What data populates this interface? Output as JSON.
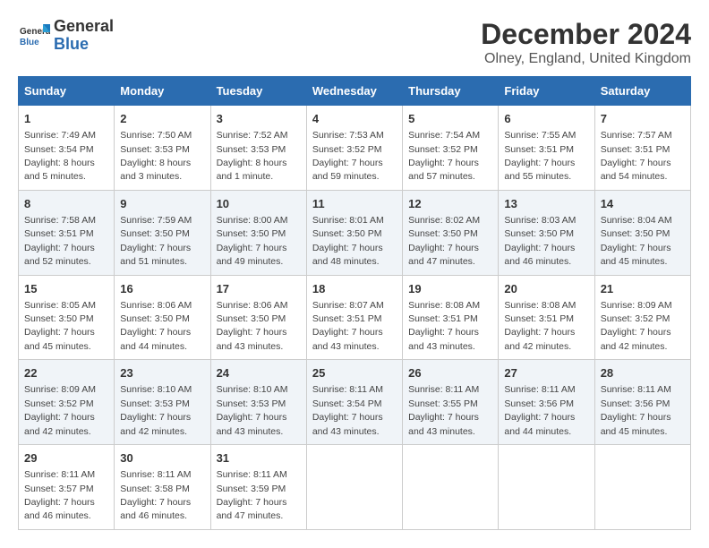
{
  "logo": {
    "line1": "General",
    "line2": "Blue"
  },
  "title": "December 2024",
  "location": "Olney, England, United Kingdom",
  "days_header": [
    "Sunday",
    "Monday",
    "Tuesday",
    "Wednesday",
    "Thursday",
    "Friday",
    "Saturday"
  ],
  "weeks": [
    [
      {
        "day": "1",
        "info": "Sunrise: 7:49 AM\nSunset: 3:54 PM\nDaylight: 8 hours\nand 5 minutes."
      },
      {
        "day": "2",
        "info": "Sunrise: 7:50 AM\nSunset: 3:53 PM\nDaylight: 8 hours\nand 3 minutes."
      },
      {
        "day": "3",
        "info": "Sunrise: 7:52 AM\nSunset: 3:53 PM\nDaylight: 8 hours\nand 1 minute."
      },
      {
        "day": "4",
        "info": "Sunrise: 7:53 AM\nSunset: 3:52 PM\nDaylight: 7 hours\nand 59 minutes."
      },
      {
        "day": "5",
        "info": "Sunrise: 7:54 AM\nSunset: 3:52 PM\nDaylight: 7 hours\nand 57 minutes."
      },
      {
        "day": "6",
        "info": "Sunrise: 7:55 AM\nSunset: 3:51 PM\nDaylight: 7 hours\nand 55 minutes."
      },
      {
        "day": "7",
        "info": "Sunrise: 7:57 AM\nSunset: 3:51 PM\nDaylight: 7 hours\nand 54 minutes."
      }
    ],
    [
      {
        "day": "8",
        "info": "Sunrise: 7:58 AM\nSunset: 3:51 PM\nDaylight: 7 hours\nand 52 minutes."
      },
      {
        "day": "9",
        "info": "Sunrise: 7:59 AM\nSunset: 3:50 PM\nDaylight: 7 hours\nand 51 minutes."
      },
      {
        "day": "10",
        "info": "Sunrise: 8:00 AM\nSunset: 3:50 PM\nDaylight: 7 hours\nand 49 minutes."
      },
      {
        "day": "11",
        "info": "Sunrise: 8:01 AM\nSunset: 3:50 PM\nDaylight: 7 hours\nand 48 minutes."
      },
      {
        "day": "12",
        "info": "Sunrise: 8:02 AM\nSunset: 3:50 PM\nDaylight: 7 hours\nand 47 minutes."
      },
      {
        "day": "13",
        "info": "Sunrise: 8:03 AM\nSunset: 3:50 PM\nDaylight: 7 hours\nand 46 minutes."
      },
      {
        "day": "14",
        "info": "Sunrise: 8:04 AM\nSunset: 3:50 PM\nDaylight: 7 hours\nand 45 minutes."
      }
    ],
    [
      {
        "day": "15",
        "info": "Sunrise: 8:05 AM\nSunset: 3:50 PM\nDaylight: 7 hours\nand 45 minutes."
      },
      {
        "day": "16",
        "info": "Sunrise: 8:06 AM\nSunset: 3:50 PM\nDaylight: 7 hours\nand 44 minutes."
      },
      {
        "day": "17",
        "info": "Sunrise: 8:06 AM\nSunset: 3:50 PM\nDaylight: 7 hours\nand 43 minutes."
      },
      {
        "day": "18",
        "info": "Sunrise: 8:07 AM\nSunset: 3:51 PM\nDaylight: 7 hours\nand 43 minutes."
      },
      {
        "day": "19",
        "info": "Sunrise: 8:08 AM\nSunset: 3:51 PM\nDaylight: 7 hours\nand 43 minutes."
      },
      {
        "day": "20",
        "info": "Sunrise: 8:08 AM\nSunset: 3:51 PM\nDaylight: 7 hours\nand 42 minutes."
      },
      {
        "day": "21",
        "info": "Sunrise: 8:09 AM\nSunset: 3:52 PM\nDaylight: 7 hours\nand 42 minutes."
      }
    ],
    [
      {
        "day": "22",
        "info": "Sunrise: 8:09 AM\nSunset: 3:52 PM\nDaylight: 7 hours\nand 42 minutes."
      },
      {
        "day": "23",
        "info": "Sunrise: 8:10 AM\nSunset: 3:53 PM\nDaylight: 7 hours\nand 42 minutes."
      },
      {
        "day": "24",
        "info": "Sunrise: 8:10 AM\nSunset: 3:53 PM\nDaylight: 7 hours\nand 43 minutes."
      },
      {
        "day": "25",
        "info": "Sunrise: 8:11 AM\nSunset: 3:54 PM\nDaylight: 7 hours\nand 43 minutes."
      },
      {
        "day": "26",
        "info": "Sunrise: 8:11 AM\nSunset: 3:55 PM\nDaylight: 7 hours\nand 43 minutes."
      },
      {
        "day": "27",
        "info": "Sunrise: 8:11 AM\nSunset: 3:56 PM\nDaylight: 7 hours\nand 44 minutes."
      },
      {
        "day": "28",
        "info": "Sunrise: 8:11 AM\nSunset: 3:56 PM\nDaylight: 7 hours\nand 45 minutes."
      }
    ],
    [
      {
        "day": "29",
        "info": "Sunrise: 8:11 AM\nSunset: 3:57 PM\nDaylight: 7 hours\nand 46 minutes."
      },
      {
        "day": "30",
        "info": "Sunrise: 8:11 AM\nSunset: 3:58 PM\nDaylight: 7 hours\nand 46 minutes."
      },
      {
        "day": "31",
        "info": "Sunrise: 8:11 AM\nSunset: 3:59 PM\nDaylight: 7 hours\nand 47 minutes."
      },
      {
        "day": "",
        "info": ""
      },
      {
        "day": "",
        "info": ""
      },
      {
        "day": "",
        "info": ""
      },
      {
        "day": "",
        "info": ""
      }
    ]
  ]
}
